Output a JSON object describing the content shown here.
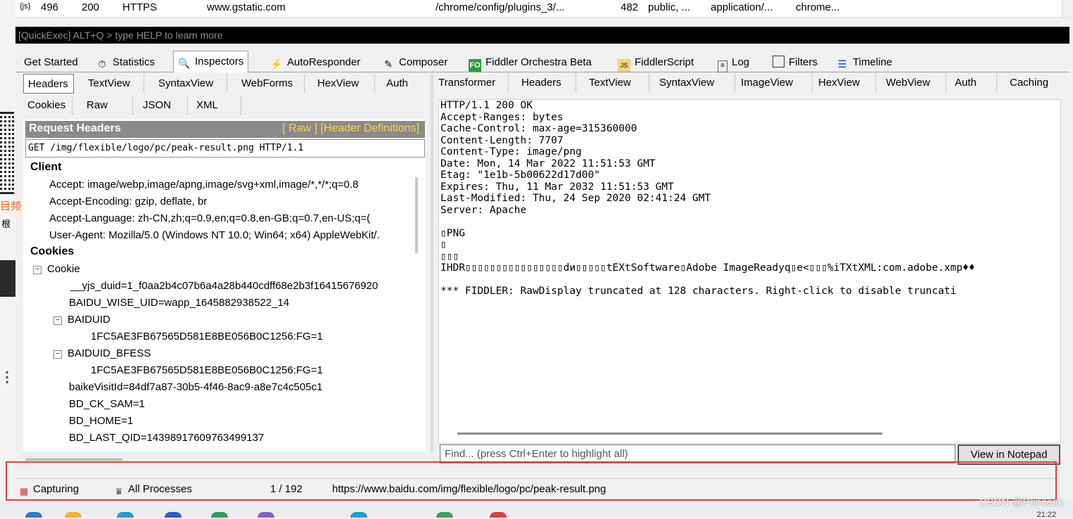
{
  "session_row": {
    "icon": "{js}",
    "id": "496",
    "result": "200",
    "protocol": "HTTPS",
    "host": "www.gstatic.com",
    "url": "/chrome/config/plugins_3/...",
    "body": "482",
    "caching": "public, ...",
    "content_type": "application/...",
    "process": "chrome..."
  },
  "quickexec": "[QuickExec] ALT+Q > type HELP to learn more",
  "tabs": [
    "Get Started",
    "Statistics",
    "Inspectors",
    "AutoResponder",
    "Composer",
    "Fiddler Orchestra Beta",
    "FiddlerScript",
    "Log",
    "Filters",
    "Timeline"
  ],
  "request_tabs_row1": [
    "Headers",
    "TextView",
    "SyntaxView",
    "WebForms",
    "HexView",
    "Auth"
  ],
  "request_tabs_row2": [
    "Cookies",
    "Raw",
    "JSON",
    "XML"
  ],
  "response_tabs": [
    "Transformer",
    "Headers",
    "TextView",
    "SyntaxView",
    "ImageView",
    "HexView",
    "WebView",
    "Auth",
    "Caching"
  ],
  "request_headers": {
    "title": "Request Headers",
    "links": "[ Raw ]   [Header Definitions]",
    "request_line": "GET /img/flexible/logo/pc/peak-result.png HTTP/1.1",
    "client_group": "Client",
    "client": [
      "Accept: image/webp,image/apng,image/svg+xml,image/*,*/*;q=0.8",
      "Accept-Encoding: gzip, deflate, br",
      "Accept-Language: zh-CN,zh;q=0.9,en;q=0.8,en-GB;q=0.7,en-US;q=(",
      "User-Agent: Mozilla/5.0 (Windows NT 10.0; Win64; x64) AppleWebKit/."
    ],
    "cookies_group": "Cookies",
    "cookie_node": "Cookie",
    "cookie_items": [
      "__yjs_duid=1_f0aa2b4c07b6a4a28b440cdff68e2b3f16415676920",
      "BAIDU_WISE_UID=wapp_1645882938522_14"
    ],
    "baiduid_node": "BAIDUID",
    "baiduid_value": "1FC5AE3FB67565D581E8BE056B0C1256:FG=1",
    "baiduid_bfess_node": "BAIDUID_BFESS",
    "baiduid_bfess_value": "1FC5AE3FB67565D581E8BE056B0C1256:FG=1",
    "more_items": [
      "baikeVisitId=84df7a87-30b5-4f46-8ac9-a8e7c4c505c1",
      "BD_CK_SAM=1",
      "BD_HOME=1",
      "BD_LAST_QID=14398917609763499137"
    ]
  },
  "response_raw": [
    "HTTP/1.1 200 OK",
    "Accept-Ranges: bytes",
    "Cache-Control: max-age=315360000",
    "Content-Length: 7707",
    "Content-Type: image/png",
    "Date: Mon, 14 Mar 2022 11:51:53 GMT",
    "Etag: \"1e1b-5b00622d17d00\"",
    "Expires: Thu, 11 Mar 2032 11:51:53 GMT",
    "Last-Modified: Thu, 24 Sep 2020 02:41:24 GMT",
    "Server: Apache",
    "",
    "▯PNG",
    "▯",
    "▯▯▯",
    "IHDR▯▯▯▯▯▯▯▯▯▯▯▯▯▯▯▯dи▯▯▯▯▯tEXtSoftware▯Adobe ImageReadyq▯e<▯▯▯%iTXtXML:com.adobe.xmp♦♦",
    "",
    "*** FIDDLER: RawDisplay truncated at 128 characters. Right-click to disable truncati"
  ],
  "find_placeholder": "Find... (press Ctrl+Enter to highlight all)",
  "view_in_notepad": "View in Notepad",
  "status": {
    "capturing": "Capturing",
    "processes": "All Processes",
    "count": "1 / 192",
    "url": "https://www.baidu.com/img/flexible/logo/pc/peak-result.png"
  },
  "watermark": "CSDN @Princesk",
  "clock": "21:22",
  "left_edge_text": "目频",
  "left_edge_char": "根",
  "colors": {
    "req_header_bg": "#8a8a8a",
    "req_links": "#ffd24a",
    "highlight_box": "#e0403c",
    "quickexec_bg": "#000000"
  }
}
